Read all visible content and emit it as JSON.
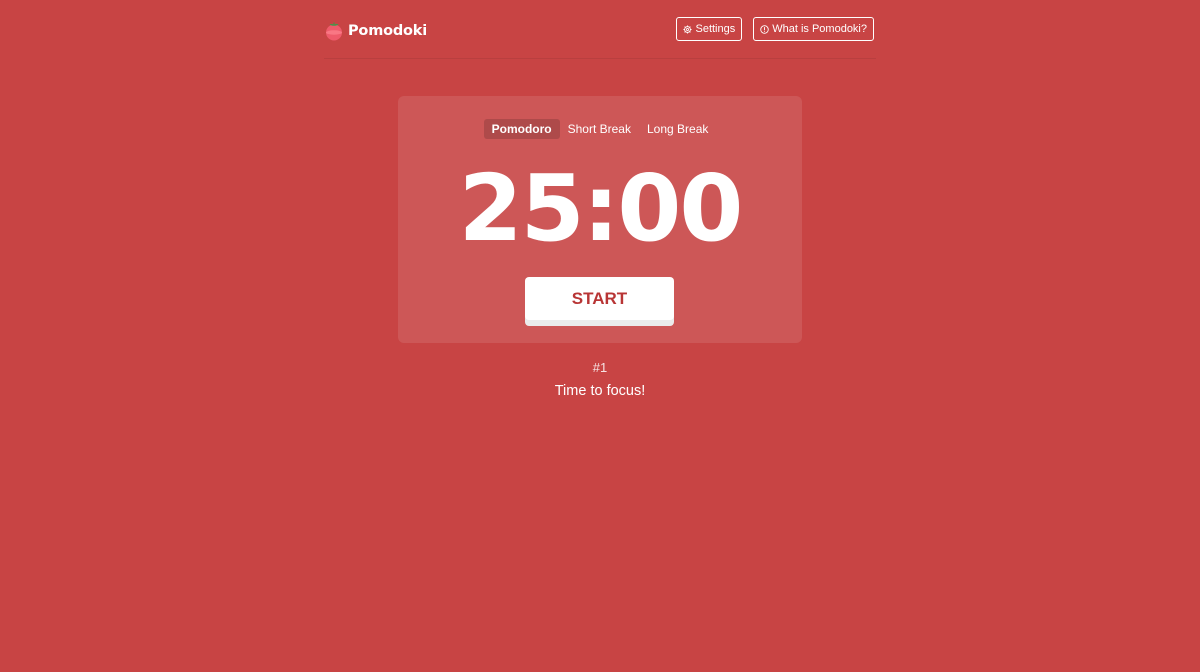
{
  "colors": {
    "background": "#c84444",
    "accent_text": "#b83535",
    "foreground": "#ffffff"
  },
  "header": {
    "brand": "Pomodoki",
    "logo_icon": "tomato-icon",
    "settings": {
      "icon": "gear-icon",
      "label": "Settings"
    },
    "about": {
      "icon": "info-circle-icon",
      "label": "What is Pomodoki?"
    }
  },
  "timer": {
    "modes": [
      {
        "label": "Pomodoro",
        "active": true
      },
      {
        "label": "Short Break",
        "active": false
      },
      {
        "label": "Long Break",
        "active": false
      }
    ],
    "time": "25:00",
    "start_label": "START"
  },
  "status": {
    "count": "#1",
    "message": "Time to focus!"
  }
}
